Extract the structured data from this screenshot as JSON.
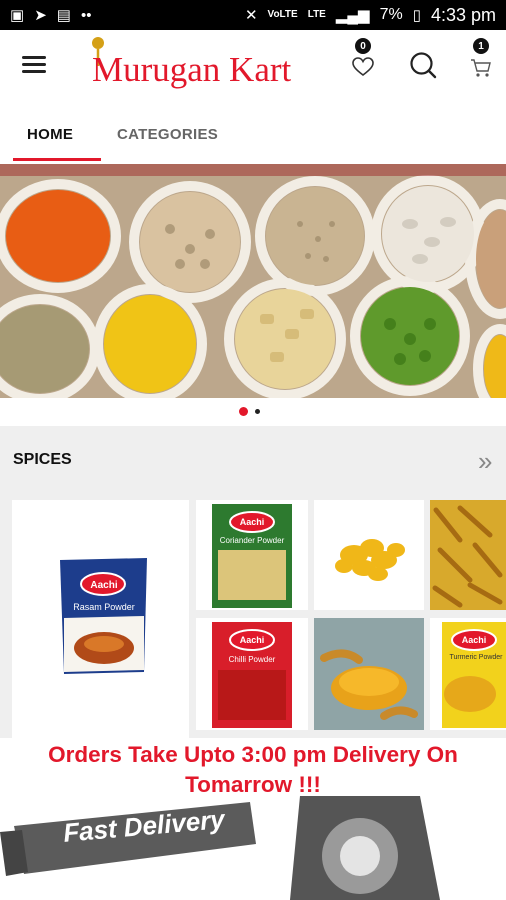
{
  "status_bar": {
    "battery": "7%",
    "time": "4:33 pm",
    "network": "LTE",
    "volte": "VoLTE"
  },
  "header": {
    "brand": "Murugan Kart",
    "wishlist_count": "0",
    "cart_count": "1"
  },
  "tabs": [
    {
      "label": "HOME",
      "active": true
    },
    {
      "label": "CATEGORIES",
      "active": false
    }
  ],
  "banner": {
    "slide_count": 2,
    "active_slide": 1
  },
  "spices": {
    "title": "SPICES",
    "products": [
      {
        "brand": "Aachi",
        "name": "Rasam Powder"
      },
      {
        "brand": "Aachi",
        "name": "Coriander Powder"
      },
      {
        "brand": "Aachi",
        "name": "Chilli Powder"
      },
      {
        "brand": "Aachi",
        "name": "Turmeric Powder"
      }
    ]
  },
  "notice": {
    "text": "Orders Take Upto 3:00 pm Delivery On Tomarrow !!!",
    "ribbon": "Fast Delivery"
  },
  "colors": {
    "accent": "#e2182b",
    "status_bar": "#000000",
    "section_bg": "#efefef"
  }
}
